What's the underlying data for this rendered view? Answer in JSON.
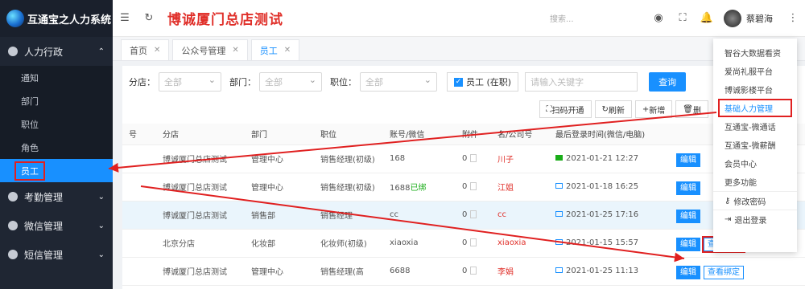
{
  "app": {
    "logo_text": "互通宝之人力系统"
  },
  "header": {
    "title": "博诚厦门总店测试",
    "search_placeholder": "搜索...",
    "user_name": "蔡碧海"
  },
  "sidebar": {
    "groups": [
      {
        "label": "人力行政"
      },
      {
        "label": "考勤管理"
      },
      {
        "label": "微信管理"
      },
      {
        "label": "短信管理"
      }
    ],
    "items": [
      {
        "label": "通知"
      },
      {
        "label": "部门"
      },
      {
        "label": "职位"
      },
      {
        "label": "角色"
      },
      {
        "label": "员工"
      }
    ]
  },
  "tabs": [
    {
      "label": "首页"
    },
    {
      "label": "公众号管理"
    },
    {
      "label": "员工"
    }
  ],
  "filters": {
    "branch_label": "分店：",
    "branch_value": "全部",
    "dept_label": "部门：",
    "dept_value": "全部",
    "pos_label": "职位：",
    "pos_value": "全部",
    "employed_label": "员工 (在职)",
    "keyword_placeholder": "请输入关键字",
    "query": "查询"
  },
  "actions": {
    "scan": "扫码开通",
    "refresh": "刷新",
    "add": "新增",
    "delete": "删"
  },
  "table": {
    "headers": [
      "号",
      "分店",
      "部门",
      "职位",
      "账号/微信",
      "附件",
      "名/公司号",
      "最后登录时间(微信/电脑)"
    ],
    "rows": [
      {
        "branch": "博诚厦门总店测试",
        "dept": "管理中心",
        "position": "销售经理(初级)",
        "account": "168",
        "bound": "",
        "attach": "0",
        "name": "川子",
        "login": "2021-01-21 12:27"
      },
      {
        "branch": "博诚厦门总店测试",
        "dept": "管理中心",
        "position": "销售经理(初级)",
        "account": "1688",
        "bound": "已绑",
        "attach": "0",
        "name": "江姐",
        "login": "2021-01-18 16:25"
      },
      {
        "branch": "博诚厦门总店测试",
        "dept": "销售部",
        "position": "销售经理",
        "account": "cc",
        "bound": "",
        "attach": "0",
        "name": "cc",
        "login": "2021-01-25 17:16"
      },
      {
        "branch": "北京分店",
        "dept": "化妆部",
        "position": "化妆师(初级)",
        "account": "xiaoxia",
        "bound": "",
        "attach": "0",
        "name": "xiaoxia",
        "login": "2021-01-15 15:57"
      },
      {
        "branch": "博诚厦门总店测试",
        "dept": "管理中心",
        "position": "销售经理(高",
        "account": "6688",
        "bound": "",
        "attach": "0",
        "name": "李娟",
        "login": "2021-01-25 11:13"
      }
    ],
    "edit": "编辑",
    "view_bind": "查看绑定"
  },
  "dropdown": [
    "智谷大数据看资",
    "爱尚礼服平台",
    "博诚影楼平台",
    "基础人力管理",
    "互通宝-微通话",
    "互通宝-微薪酬",
    "会员中心",
    "更多功能",
    "修改密码",
    "退出登录"
  ]
}
